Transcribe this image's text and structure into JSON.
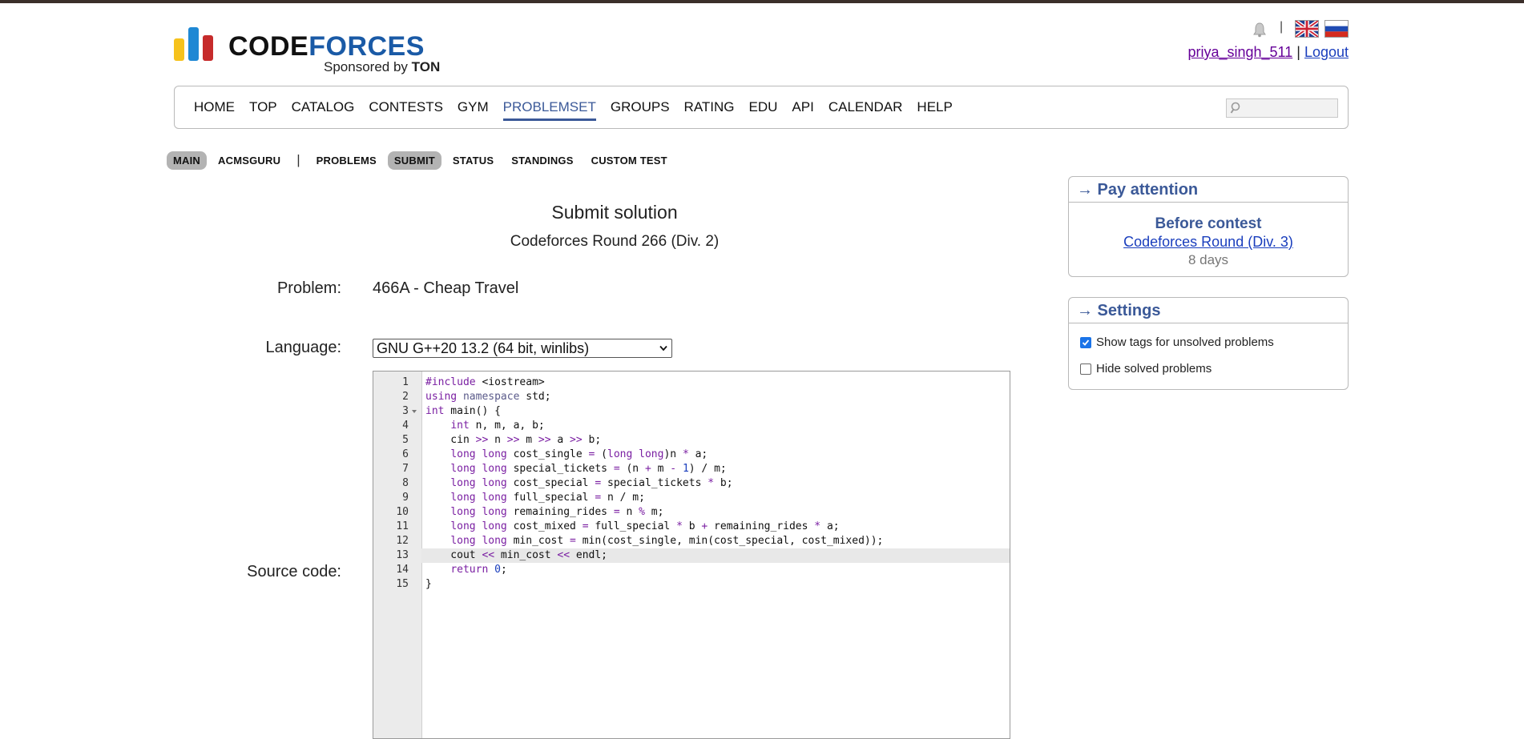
{
  "header": {
    "logo_text_black": "CODE",
    "logo_text_blue": "FORCES",
    "sponsored_prefix": "Sponsored by",
    "sponsored_brand": "TON",
    "username": "priya_singh_511",
    "separator": "|",
    "logout": "Logout"
  },
  "main_menu": {
    "items": [
      "HOME",
      "TOP",
      "CATALOG",
      "CONTESTS",
      "GYM",
      "PROBLEMSET",
      "GROUPS",
      "RATING",
      "EDU",
      "API",
      "CALENDAR",
      "HELP"
    ],
    "active": "PROBLEMSET",
    "search_placeholder": ""
  },
  "sub_menu": {
    "left": [
      "MAIN",
      "ACMSGURU"
    ],
    "right": [
      "PROBLEMS",
      "SUBMIT",
      "STATUS",
      "STANDINGS",
      "CUSTOM TEST"
    ],
    "active": [
      "MAIN",
      "SUBMIT"
    ]
  },
  "submit": {
    "title": "Submit solution",
    "contest": "Codeforces Round 266 (Div. 2)",
    "problem_label": "Problem:",
    "problem_value": "466A - Cheap Travel",
    "language_label": "Language:",
    "language_value": "GNU G++20 13.2 (64 bit, winlibs)",
    "source_label": "Source code:"
  },
  "code": {
    "active_line": 13,
    "lines": [
      "#include <iostream>",
      "using namespace std;",
      "int main() {",
      "    int n, m, a, b;",
      "    cin >> n >> m >> a >> b;",
      "    long long cost_single = (long long)n * a;",
      "    long long special_tickets = (n + m - 1) / m;",
      "    long long cost_special = special_tickets * b;",
      "    long long full_special = n / m;",
      "    long long remaining_rides = n % m;",
      "    long long cost_mixed = full_special * b + remaining_rides * a;",
      "    long long min_cost = min(cost_single, min(cost_special, cost_mixed));",
      "    cout << min_cost << endl;",
      "    return 0;",
      "}"
    ]
  },
  "sidebar": {
    "attention": {
      "header": "→ Pay attention",
      "title": "Before contest",
      "link": "Codeforces Round (Div. 3)",
      "time": "8 days"
    },
    "settings": {
      "header": "→ Settings",
      "options": [
        {
          "label": "Show tags for unsolved problems",
          "checked": true
        },
        {
          "label": "Hide solved problems",
          "checked": false
        }
      ]
    }
  },
  "colors": {
    "accent": "#3b5998",
    "link": "#1a3ebd",
    "username": "#660099"
  }
}
